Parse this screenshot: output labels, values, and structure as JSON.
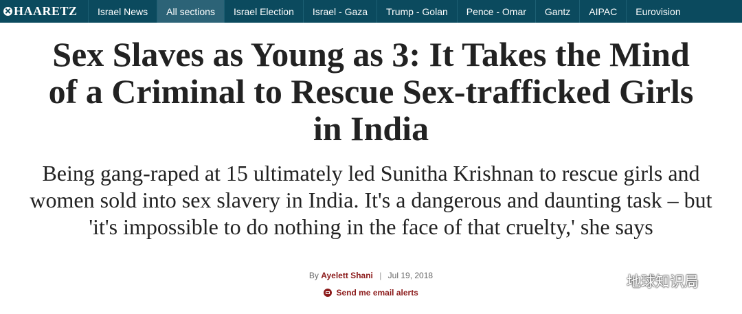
{
  "nav": {
    "logo": "HAARETZ",
    "items": [
      {
        "label": "Israel News"
      },
      {
        "label": "All sections"
      },
      {
        "label": "Israel Election"
      },
      {
        "label": "Israel - Gaza"
      },
      {
        "label": "Trump - Golan"
      },
      {
        "label": "Pence - Omar"
      },
      {
        "label": "Gantz"
      },
      {
        "label": "AIPAC"
      },
      {
        "label": "Eurovision"
      }
    ],
    "active_index": 1
  },
  "article": {
    "headline": "Sex Slaves as Young as 3: It Takes the Mind of a Criminal to Rescue Sex-trafficked Girls in India",
    "subheadline": "Being gang-raped at 15 ultimately led Sunitha Krishnan to rescue girls and women sold into sex slavery in India. It's a dangerous and daunting task – but 'it's impossible to do nothing in the face of that cruelty,' she says",
    "byline_prefix": "By",
    "author": "Ayelett Shani",
    "separator": "|",
    "date": "Jul 19, 2018",
    "email_alerts": "Send me email alerts"
  },
  "watermark": {
    "text": "地球知识局",
    "icon": "wechat-icon"
  },
  "colors": {
    "nav_bg": "#0b4a5e",
    "nav_active_bg": "#2c6377",
    "accent": "#8b1a1a"
  }
}
